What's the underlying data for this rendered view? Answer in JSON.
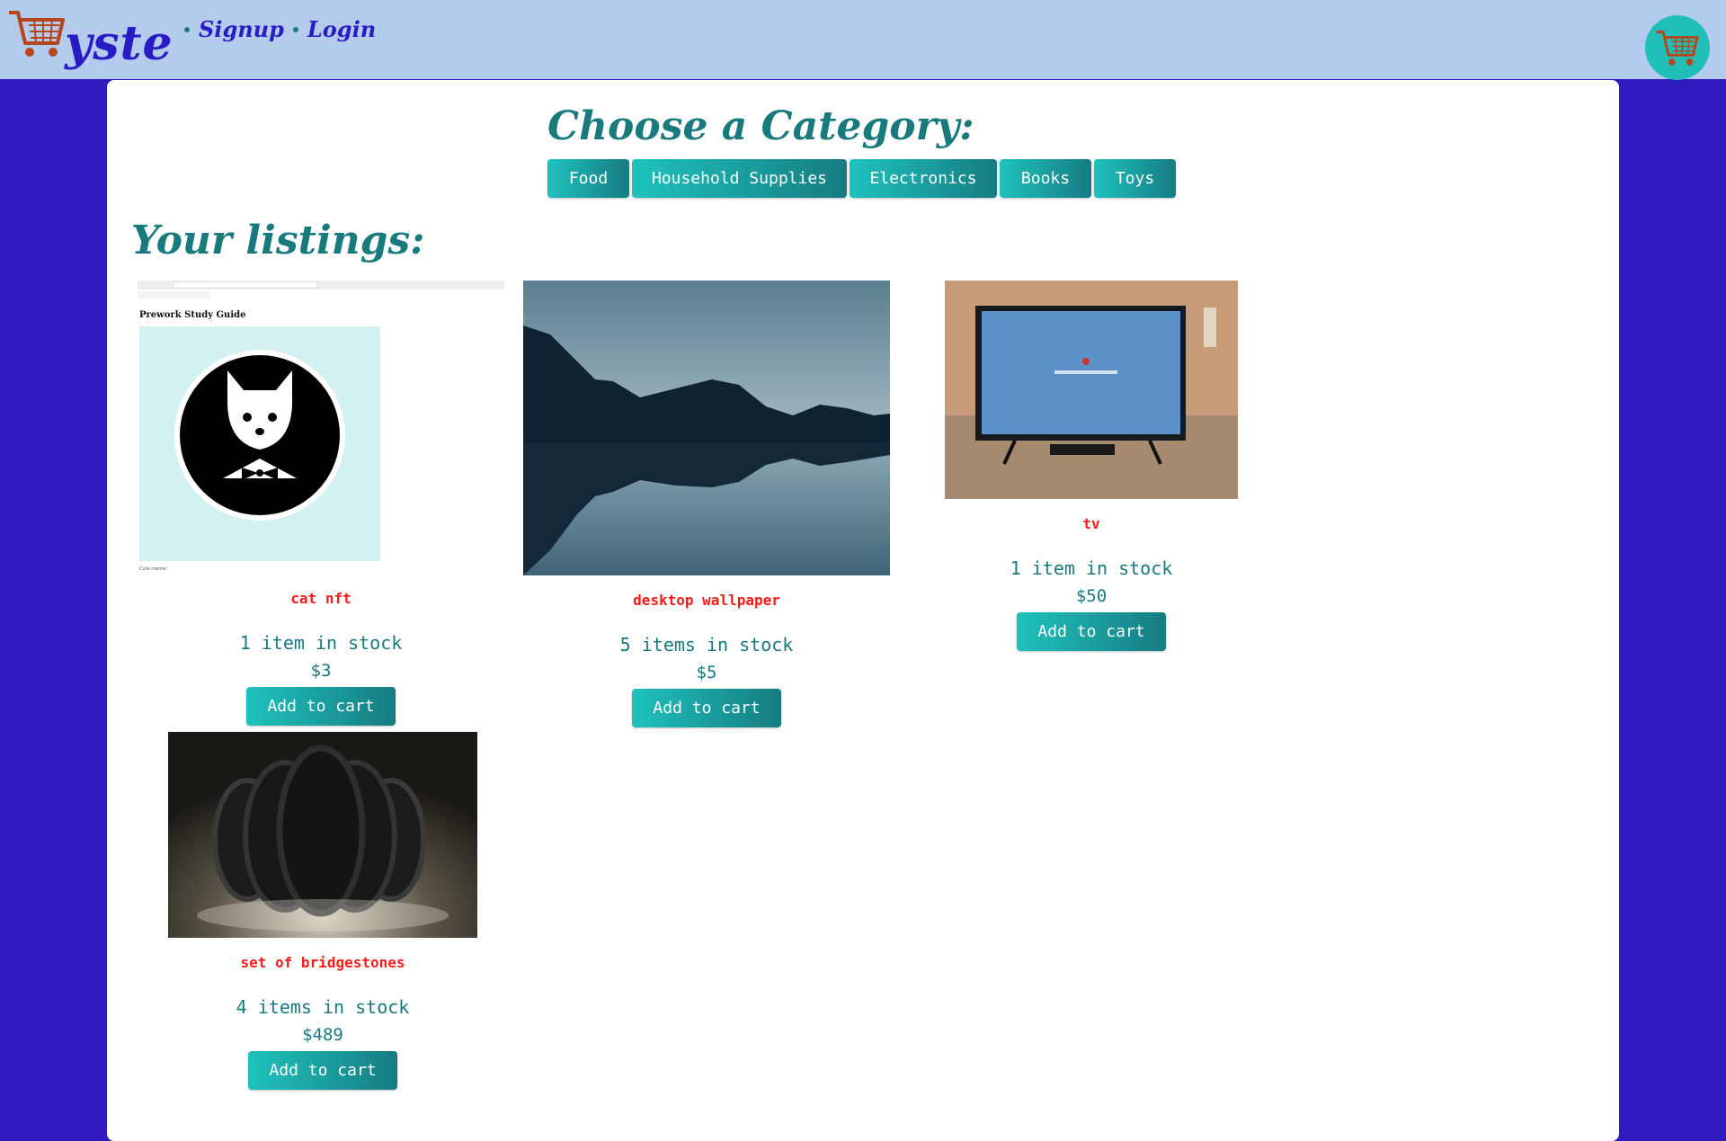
{
  "header": {
    "brand": "yste",
    "nav": [
      "Signup",
      "Login"
    ]
  },
  "categories": {
    "heading": "Choose a Category:",
    "items": [
      "Food",
      "Household Supplies",
      "Electronics",
      "Books",
      "Toys"
    ]
  },
  "listings": {
    "heading": "Your listings:",
    "items": [
      {
        "title": "cat nft",
        "stock": "1 item in stock",
        "price": "$3",
        "button": "Add to cart",
        "image_text": "Prework Study Guide",
        "image_caption": "Cute meme!"
      },
      {
        "title": "desktop wallpaper",
        "stock": "5 items in stock",
        "price": "$5",
        "button": "Add to cart"
      },
      {
        "title": "tv",
        "stock": "1 item in stock",
        "price": "$50",
        "button": "Add to cart"
      },
      {
        "title": "set of bridgestones",
        "stock": "4 items in stock",
        "price": "$489",
        "button": "Add to cart"
      }
    ]
  },
  "colors": {
    "background": "#301bc0",
    "header": "#b3cbec",
    "accent": "#197a7e",
    "title_red": "#ff1a1a",
    "cart_circle": "#1fbfb8"
  },
  "icons": [
    "shopping-cart-icon",
    "cart-icon"
  ]
}
